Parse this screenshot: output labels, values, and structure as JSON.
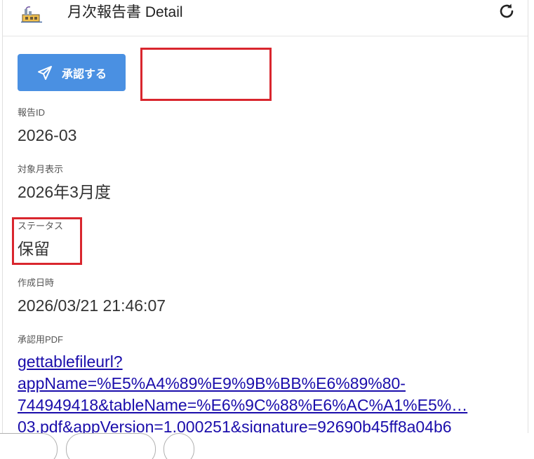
{
  "header": {
    "title": "月次報告書 Detail",
    "app_icon": "factory-icon",
    "refresh_icon": "refresh-icon"
  },
  "actions": {
    "approve_label": "承認する",
    "approve_icon": "paper-plane-icon",
    "accent_color": "#4a90e2"
  },
  "fields": {
    "report_id": {
      "label": "報告ID",
      "value": "2026-03"
    },
    "target_month": {
      "label": "対象月表示",
      "value": "2026年3月度"
    },
    "status": {
      "label": "ステータス",
      "value": "保留"
    },
    "created_at": {
      "label": "作成日時",
      "value": "2026/03/21 21:46:07"
    },
    "pdf": {
      "label": "承認用PDF",
      "link_lines": [
        "gettablefileurl?",
        "appName=%E5%A4%89%E9%9B%BB%E6%89%80-",
        "744949418&tableName=%E6%9C%88%E6%AC%A1%E5%…",
        "03.pdf&appVersion=1.000251&signature=92690b45ff8a04b6"
      ]
    }
  },
  "highlight_color": "#d9262e"
}
